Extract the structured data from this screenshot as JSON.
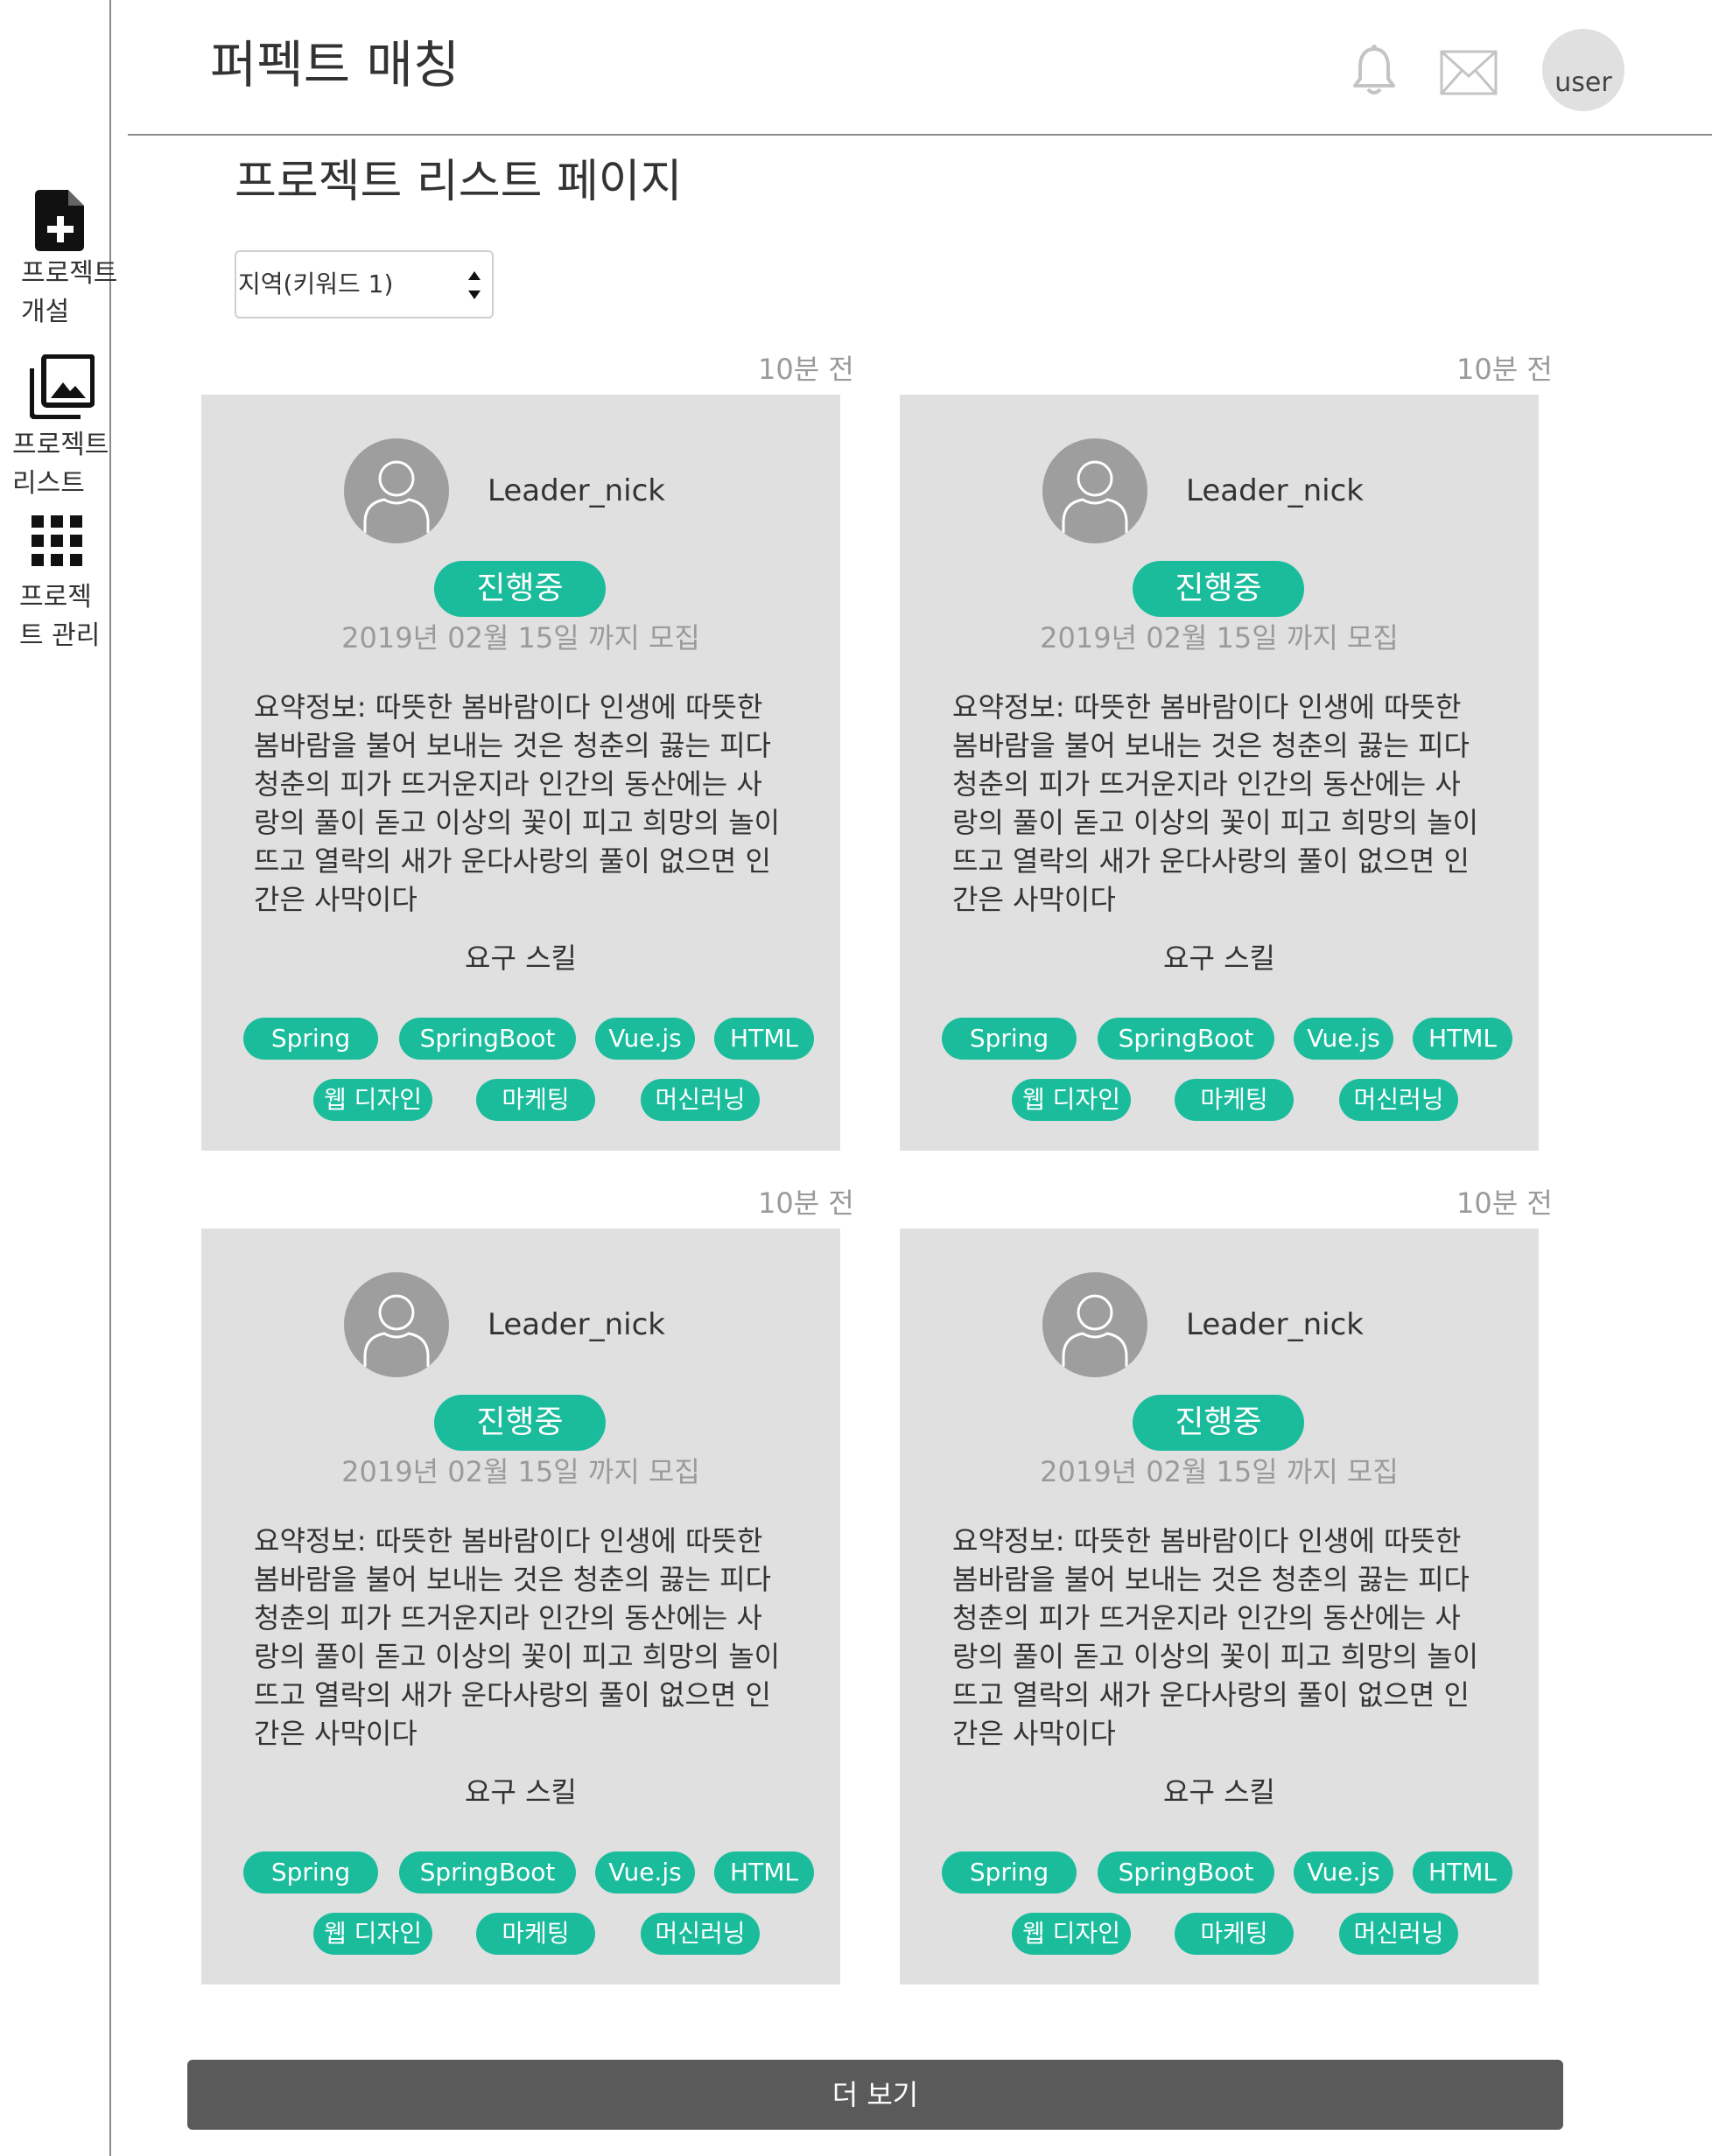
{
  "header": {
    "title": "퍼펙트 매칭",
    "icons": [
      "bell-icon",
      "mail-icon"
    ],
    "user_label": "user"
  },
  "sidebar": {
    "items": [
      {
        "icon": "file-add-icon",
        "label_line1": "프로젝트",
        "label_line2": "개설"
      },
      {
        "icon": "image-gallery-icon",
        "label_line1": "프로젝트",
        "label_line2": "리스트"
      },
      {
        "icon": "grid-icon",
        "label_line1": "프로젝",
        "label_line2": "트 관리"
      }
    ]
  },
  "main": {
    "page_title": "프로젝트 리스트 페이지",
    "filter": {
      "value": "지역(키워드 1)"
    },
    "cards": [
      {
        "time": "10분 전",
        "leader": "Leader_nick",
        "status": "진행중",
        "deadline": "2019년 02월 15일 까지 모집",
        "summary_lines": [
          "요약정보: 따뜻한 봄바람이다 인생에 따뜻한",
          "봄바람을 불어 보내는 것은 청춘의 끓는 피다",
          "청춘의 피가 뜨거운지라 인간의 동산에는 사",
          "랑의 풀이 돋고 이상의 꽃이 피고 희망의 놀이",
          "뜨고 열락의 새가 운다사랑의 풀이 없으면 인",
          "간은 사막이다"
        ],
        "skills_title": "요구 스킬",
        "skills": [
          "Spring",
          "SpringBoot",
          "Vue.js",
          "HTML",
          "웹 디자인",
          "마케팅",
          "머신러닝"
        ]
      },
      {
        "time": "10분 전",
        "leader": "Leader_nick",
        "status": "진행중",
        "deadline": "2019년 02월 15일 까지 모집",
        "summary_lines": [
          "요약정보: 따뜻한 봄바람이다 인생에 따뜻한",
          "봄바람을 불어 보내는 것은 청춘의 끓는 피다",
          "청춘의 피가 뜨거운지라 인간의 동산에는 사",
          "랑의 풀이 돋고 이상의 꽃이 피고 희망의 놀이",
          "뜨고 열락의 새가 운다사랑의 풀이 없으면 인",
          "간은 사막이다"
        ],
        "skills_title": "요구 스킬",
        "skills": [
          "Spring",
          "SpringBoot",
          "Vue.js",
          "HTML",
          "웹 디자인",
          "마케팅",
          "머신러닝"
        ]
      },
      {
        "time": "10분 전",
        "leader": "Leader_nick",
        "status": "진행중",
        "deadline": "2019년 02월 15일 까지 모집",
        "summary_lines": [
          "요약정보: 따뜻한 봄바람이다 인생에 따뜻한",
          "봄바람을 불어 보내는 것은 청춘의 끓는 피다",
          "청춘의 피가 뜨거운지라 인간의 동산에는 사",
          "랑의 풀이 돋고 이상의 꽃이 피고 희망의 놀이",
          "뜨고 열락의 새가 운다사랑의 풀이 없으면 인",
          "간은 사막이다"
        ],
        "skills_title": "요구 스킬",
        "skills": [
          "Spring",
          "SpringBoot",
          "Vue.js",
          "HTML",
          "웹 디자인",
          "마케팅",
          "머신러닝"
        ]
      },
      {
        "time": "10분 전",
        "leader": "Leader_nick",
        "status": "진행중",
        "deadline": "2019년 02월 15일 까지 모집",
        "summary_lines": [
          "요약정보: 따뜻한 봄바람이다 인생에 따뜻한",
          "봄바람을 불어 보내는 것은 청춘의 끓는 피다",
          "청춘의 피가 뜨거운지라 인간의 동산에는 사",
          "랑의 풀이 돋고 이상의 꽃이 피고 희망의 놀이",
          "뜨고 열락의 새가 운다사랑의 풀이 없으면 인",
          "간은 사막이다"
        ],
        "skills_title": "요구 스킬",
        "skills": [
          "Spring",
          "SpringBoot",
          "Vue.js",
          "HTML",
          "웹 디자인",
          "마케팅",
          "머신러닝"
        ]
      }
    ],
    "more_button": "더 보기"
  },
  "colors": {
    "accent": "#1abc9c",
    "card_bg": "#e0e0e0",
    "button_bg": "#5a5a5a",
    "muted_text": "#9a9a9a"
  }
}
